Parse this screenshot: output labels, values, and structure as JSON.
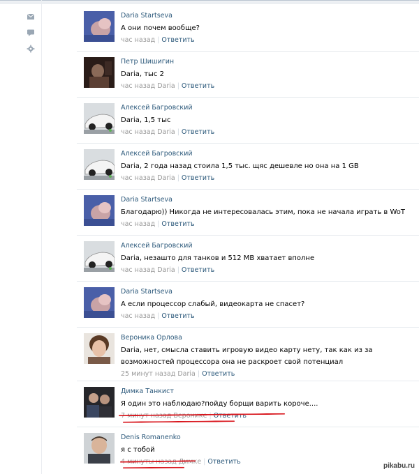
{
  "sidebar": {
    "icons": [
      "mail-icon",
      "comment-icon",
      "settings-icon"
    ]
  },
  "comments": [
    {
      "author": "Daria Startseva",
      "text": "А они почем вообще?",
      "time": "час назад",
      "reply_to": "",
      "reply": "Ответить",
      "avatar": "daria"
    },
    {
      "author": "Петр Шишигин",
      "text": "Daria, тыс 2",
      "time": "час назад",
      "reply_to": "Daria",
      "reply": "Ответить",
      "avatar": "petr"
    },
    {
      "author": "Алексей Багровский",
      "text": "Daria, 1,5 тыс",
      "time": "час назад",
      "reply_to": "Daria",
      "reply": "Ответить",
      "avatar": "car",
      "online": true
    },
    {
      "author": "Алексей Багровский",
      "text": "Daria, 2 года назад стоила 1,5 тыс. щяс дешевле но она на 1 GB",
      "time": "час назад",
      "reply_to": "Daria",
      "reply": "Ответить",
      "avatar": "car",
      "online": true
    },
    {
      "author": "Daria Startseva",
      "text": "Благодарю)) Никогда не интересовалась этим, пока не начала играть в WoT",
      "time": "час назад",
      "reply_to": "",
      "reply": "Ответить",
      "avatar": "daria"
    },
    {
      "author": "Алексей Багровский",
      "text": "Daria, незашто для танков и 512 MB хватает вполне",
      "time": "час назад",
      "reply_to": "Daria",
      "reply": "Ответить",
      "avatar": "car",
      "online": true
    },
    {
      "author": "Daria Startseva",
      "text": "А если процессор слабый, видеокарта не спасет?",
      "time": "час назад",
      "reply_to": "",
      "reply": "Ответить",
      "avatar": "daria"
    },
    {
      "author": "Вероника Орлова",
      "text": "Daria, нет, смысла ставить игровую видео карту нету, так как из за возможностей процессора она не раскроет свой потенциал",
      "time": "25 минут назад",
      "reply_to": "Daria",
      "reply": "Ответить",
      "avatar": "veronika"
    },
    {
      "author": "Димка Танкист",
      "text": "Я один это наблюдаю?пойду борщи варить короче....",
      "time": "7 минут назад",
      "reply_to": "Веронике",
      "reply": "Ответить",
      "avatar": "dimka"
    },
    {
      "author": "Denis Romanenko",
      "text": "я с тобой",
      "time": "4 минуты назад",
      "reply_to": "Димке",
      "reply": "Ответить",
      "avatar": "denis"
    }
  ],
  "watermark": "pikabu.ru",
  "colors": {
    "link": "#2b587a",
    "meta": "#999999",
    "underline": "#d8151c",
    "divider": "#e6eaee"
  }
}
